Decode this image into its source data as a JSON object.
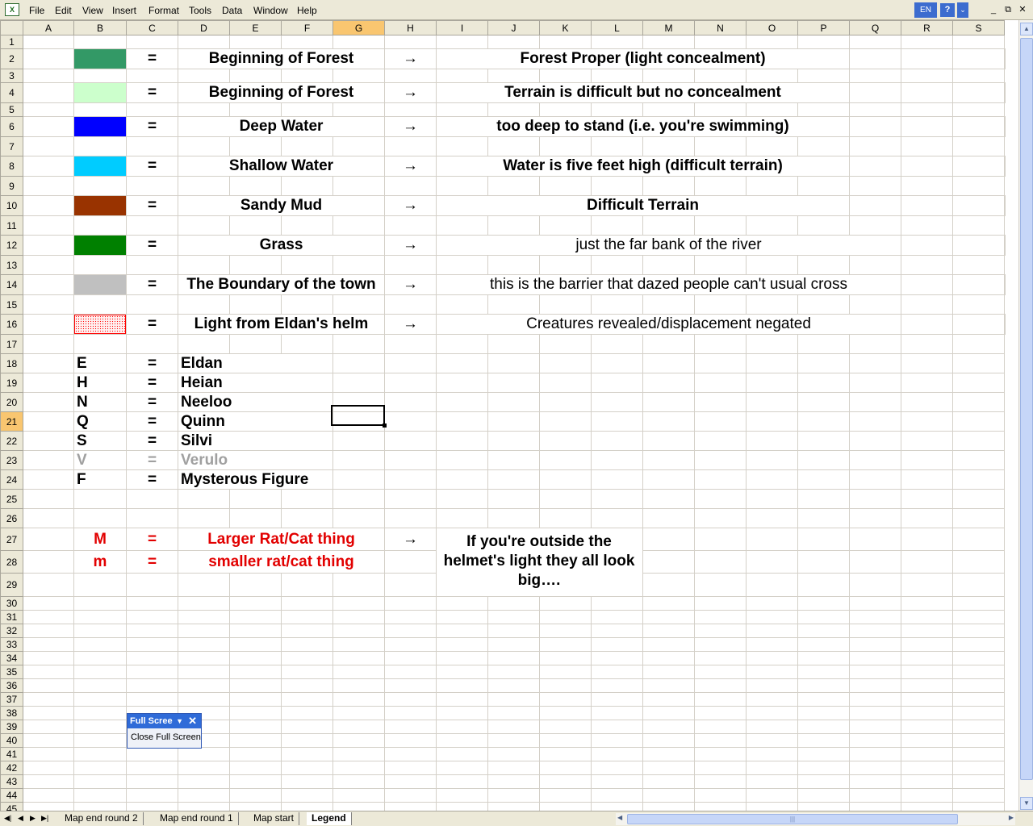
{
  "menu": [
    "File",
    "Edit",
    "View",
    "Insert",
    "Format",
    "Tools",
    "Data",
    "Window",
    "Help"
  ],
  "lang": "EN",
  "help": "?",
  "window_buttons": [
    "_",
    "⧉",
    "✕"
  ],
  "columns": [
    "A",
    "B",
    "C",
    "D",
    "E",
    "F",
    "G",
    "H",
    "I",
    "J",
    "K",
    "L",
    "M",
    "N",
    "O",
    "P",
    "Q",
    "R",
    "S"
  ],
  "rows": {
    "r1": "1",
    "r2": "2",
    "r3": "3",
    "r4": "4",
    "r5": "5",
    "r6": "6",
    "r7": "7",
    "r8": "8",
    "r9": "9",
    "r10": "10",
    "r11": "11",
    "r12": "12",
    "r13": "13",
    "r14": "14",
    "r15": "15",
    "r16": "16",
    "r17": "17",
    "r18": "18",
    "r19": "19",
    "r20": "20",
    "r21": "21",
    "r22": "22",
    "r23": "23",
    "r24": "24",
    "r25": "25",
    "r26": "26",
    "r27": "27",
    "r28": "28",
    "r29": "29",
    "r30": "30",
    "r31": "31",
    "r32": "32",
    "r33": "33",
    "r34": "34",
    "r35": "35",
    "r36": "36",
    "r37": "37",
    "r38": "38",
    "r39": "39",
    "r40": "40",
    "r41": "41",
    "r42": "42",
    "r43": "43",
    "r44": "44",
    "r45": "45"
  },
  "legend": {
    "eq": "=",
    "arrow": "→",
    "terrain": [
      {
        "color": "#339966",
        "name": "Beginning of Forest",
        "desc": "Forest Proper (light concealment)"
      },
      {
        "color": "#ccffcc",
        "name": "Beginning of Forest",
        "desc": "Terrain is difficult but no concealment"
      },
      {
        "color": "#0000ff",
        "name": "Deep Water",
        "desc": "too deep to stand (i.e. you're swimming)"
      },
      {
        "color": "#00ccff",
        "name": "Shallow Water",
        "desc": "Water is five feet high (difficult terrain)"
      },
      {
        "color": "#993300",
        "name": "Sandy Mud",
        "desc": "Difficult Terrain"
      },
      {
        "color": "#008000",
        "name": "Grass",
        "desc": "just the far bank of the river"
      },
      {
        "color": "#c0c0c0",
        "name": "The Boundary of the town",
        "desc": "this is the barrier that dazed people can't usual cross"
      },
      {
        "color": "#ff0000",
        "name": "Light from Eldan's helm",
        "desc": "Creatures revealed/displacement negated"
      }
    ],
    "characters": [
      {
        "key": "E",
        "name": "Eldan"
      },
      {
        "key": "H",
        "name": "Heian"
      },
      {
        "key": "N",
        "name": "Neeloo"
      },
      {
        "key": "Q",
        "name": "Quinn"
      },
      {
        "key": "S",
        "name": "Silvi"
      },
      {
        "key": "V",
        "name": "Verulo"
      },
      {
        "key": "F",
        "name": "Mysterous Figure"
      }
    ],
    "monsters": [
      {
        "key": "M",
        "name": "Larger Rat/Cat thing"
      },
      {
        "key": "m",
        "name": "smaller rat/cat thing"
      }
    ],
    "note": "If you're outside the helmet's light they all look big…."
  },
  "full_screen_toolbar": {
    "title": "Full Scree",
    "button": "Close Full Screen"
  },
  "tabs": [
    "Map end round 2",
    "Map end round 1",
    "Map  start",
    "Legend"
  ],
  "active_tab": "Legend",
  "selected_cell": "G21"
}
